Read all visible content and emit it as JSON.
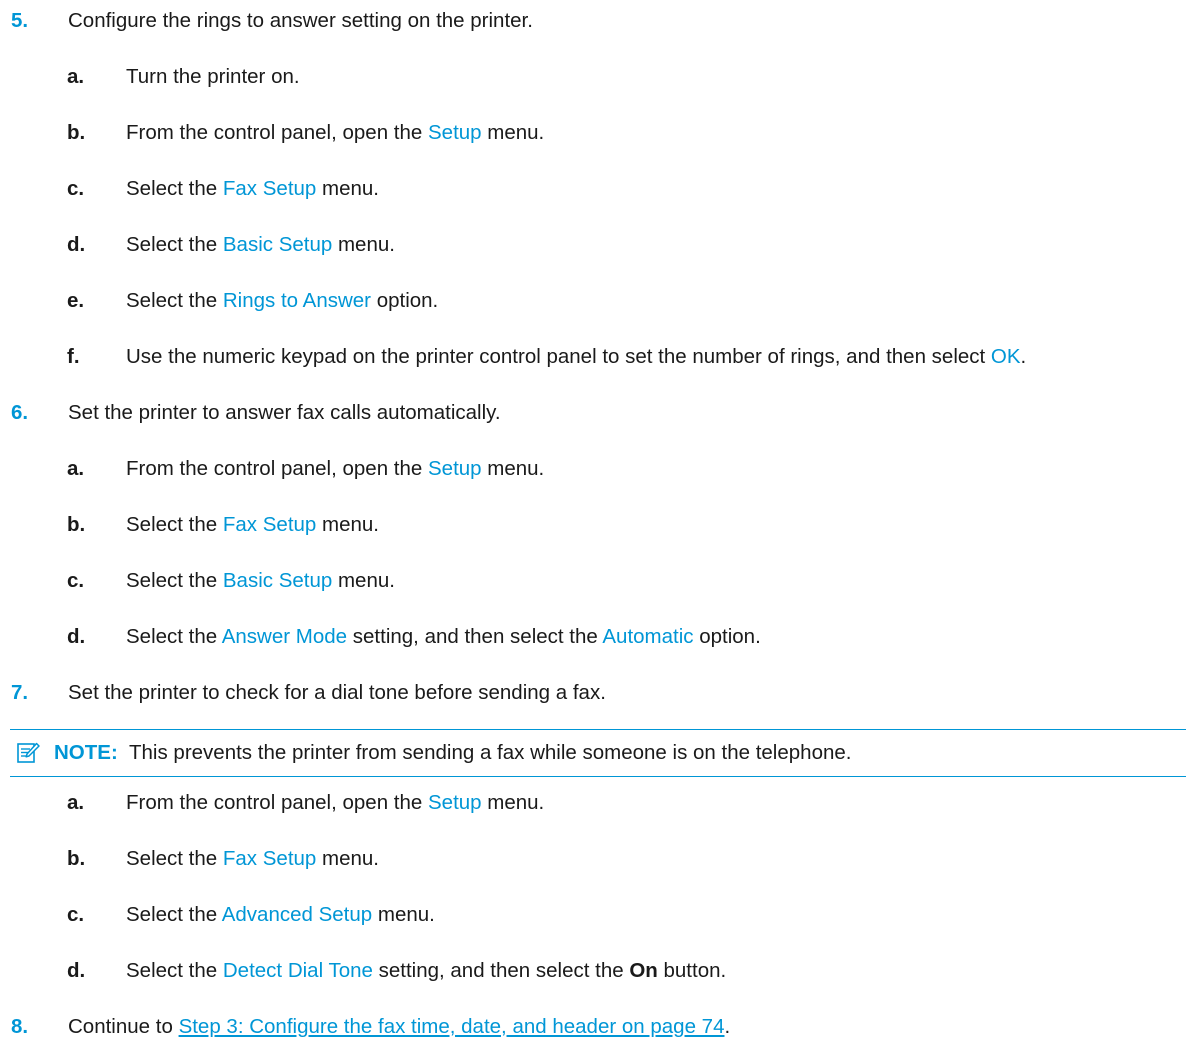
{
  "steps": {
    "s5": {
      "num": "5.",
      "text": "Configure the rings to answer setting on the printer.",
      "sub": {
        "a": {
          "letter": "a.",
          "text": "Turn the printer on."
        },
        "b": {
          "letter": "b.",
          "pre": "From the control panel, open the ",
          "ui": "Setup",
          "post": " menu."
        },
        "c": {
          "letter": "c.",
          "pre": "Select the ",
          "ui": "Fax Setup",
          "post": " menu."
        },
        "d": {
          "letter": "d.",
          "pre": "Select the ",
          "ui": "Basic Setup",
          "post": " menu."
        },
        "e": {
          "letter": "e.",
          "pre": "Select the ",
          "ui": "Rings to Answer",
          "post": " option."
        },
        "f": {
          "letter": "f.",
          "pre": "Use the numeric keypad on the printer control panel to set the number of rings, and then select ",
          "ui": "OK",
          "post": "."
        }
      }
    },
    "s6": {
      "num": "6.",
      "text": "Set the printer to answer fax calls automatically.",
      "sub": {
        "a": {
          "letter": "a.",
          "pre": "From the control panel, open the ",
          "ui": "Setup",
          "post": " menu."
        },
        "b": {
          "letter": "b.",
          "pre": "Select the ",
          "ui": "Fax Setup",
          "post": " menu."
        },
        "c": {
          "letter": "c.",
          "pre": "Select the ",
          "ui": "Basic Setup",
          "post": " menu."
        },
        "d": {
          "letter": "d.",
          "pre": "Select the ",
          "ui": "Answer Mode",
          "mid": " setting, and then select the ",
          "ui2": "Automatic",
          "post": " option."
        }
      }
    },
    "s7": {
      "num": "7.",
      "text": "Set the printer to check for a dial tone before sending a fax.",
      "note": {
        "icon": "note-icon",
        "label": "NOTE:",
        "text": "This prevents the printer from sending a fax while someone is on the telephone."
      },
      "sub": {
        "a": {
          "letter": "a.",
          "pre": "From the control panel, open the ",
          "ui": "Setup",
          "post": " menu."
        },
        "b": {
          "letter": "b.",
          "pre": "Select the ",
          "ui": "Fax Setup",
          "post": " menu."
        },
        "c": {
          "letter": "c.",
          "pre": "Select the ",
          "ui": "Advanced Setup",
          "post": " menu."
        },
        "d": {
          "letter": "d.",
          "pre": "Select the ",
          "ui": "Detect Dial Tone",
          "mid": " setting, and then select the ",
          "bold": "On",
          "post": " button."
        }
      }
    },
    "s8": {
      "num": "8.",
      "pre": "Continue to ",
      "link": "Step 3: Configure the fax time, date, and header on page 74",
      "post": "."
    }
  },
  "colors": {
    "accent": "#0096d6",
    "text": "#1a1a1a",
    "background": "#ffffff"
  }
}
